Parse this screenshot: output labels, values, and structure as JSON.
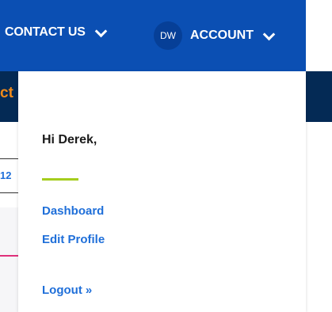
{
  "nav": {
    "contact_label": "CONTACT US",
    "account_label": "ACCOUNT",
    "avatar_initials": "DW"
  },
  "subbar": {
    "partial_text": "ct"
  },
  "page": {
    "partial_number": "12"
  },
  "dropdown": {
    "greeting": "Hi Derek,",
    "links": [
      {
        "label": "Dashboard"
      },
      {
        "label": "Edit Profile"
      },
      {
        "label": "Logout"
      }
    ],
    "logout_arrow": "»"
  },
  "colors": {
    "primary_blue": "#0b4fb3",
    "dark_navy": "#042a55",
    "link_blue": "#1f6fd9",
    "accent_green": "#a5cd1d",
    "orange": "#f08a1a"
  }
}
